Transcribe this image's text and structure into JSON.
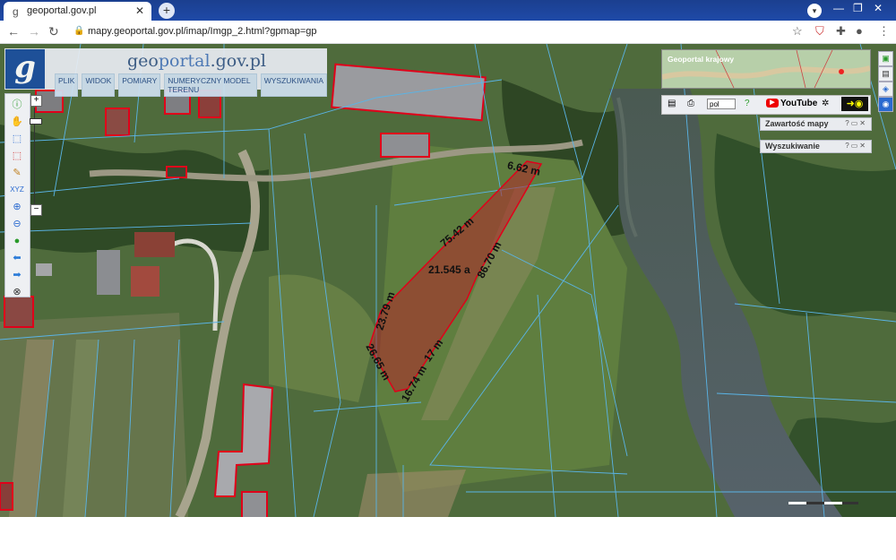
{
  "browser": {
    "tab_title": "geoportal.gov.pl",
    "tab_close": "✕",
    "new_tab": "+",
    "url": "mapy.geoportal.gov.pl/imap/Imgp_2.html?gpmap=gp",
    "window_controls": [
      "—",
      "❐",
      "✕"
    ]
  },
  "app": {
    "logo_letter": "g",
    "logo_text_part1": "geo",
    "logo_text_part2": "portal",
    "logo_text_part3": ".gov.pl",
    "menu": [
      "PLIK",
      "WIDOK",
      "POMIARY",
      "NUMERYCZNY MODEL TERENU",
      "WYSZUKIWANIA"
    ]
  },
  "overview": {
    "label": "Geoportal krajowy"
  },
  "toolstrip": {
    "language": "pol",
    "youtube": "YouTube"
  },
  "panels": [
    {
      "title": "Zawartość mapy"
    },
    {
      "title": "Wyszukiwanie"
    }
  ],
  "parcel": {
    "area": "21.545 a",
    "dimensions": [
      "6.62 m",
      "75.42 m",
      "86.70 m",
      "23.79 m",
      "26.65 m",
      "16.74 m",
      "17 m"
    ]
  },
  "colors": {
    "parcel_fill": "#b3262a",
    "building_outline": "#e0001a",
    "cadastral_lines": "#5ab4e6"
  }
}
